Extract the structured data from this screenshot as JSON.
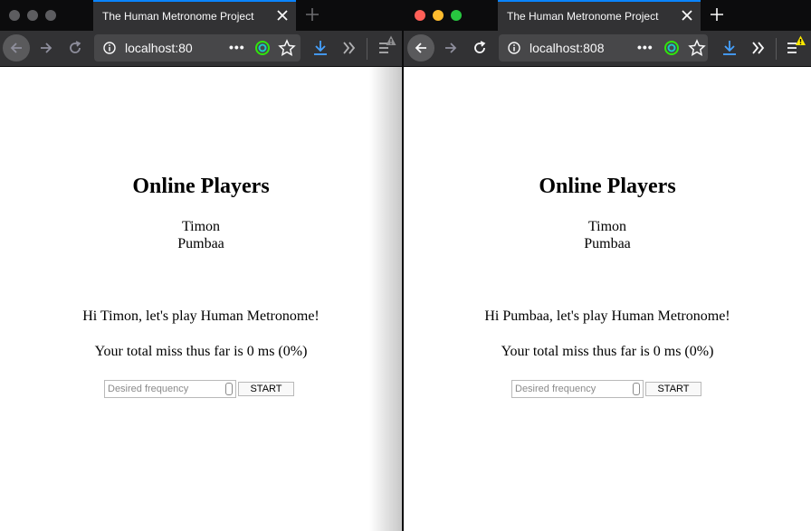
{
  "windows": {
    "left": {
      "tab_title": "The Human Metronome Project",
      "url": "localhost:80",
      "page": {
        "heading": "Online Players",
        "players": [
          "Timon",
          "Pumbaa"
        ],
        "greeting": "Hi Timon, let's play Human Metronome!",
        "miss_text": "Your total miss thus far is 0 ms (0%)",
        "frequency_placeholder": "Desired frequency",
        "start_label": "START"
      }
    },
    "right": {
      "tab_title": "The Human Metronome Project",
      "url": "localhost:808",
      "page": {
        "heading": "Online Players",
        "players": [
          "Timon",
          "Pumbaa"
        ],
        "greeting": "Hi Pumbaa, let's play Human Metronome!",
        "miss_text": "Your total miss thus far is 0 ms (0%)",
        "frequency_placeholder": "Desired frequency",
        "start_label": "START"
      }
    }
  },
  "colors": {
    "tab_accent": "#0a84ff",
    "toolbar_bg": "#323234",
    "urlbar_bg": "#474749",
    "traffic_red": "#ff5f57",
    "traffic_yellow": "#febc2e",
    "traffic_green": "#28c840",
    "warning_yellow": "#ffe900"
  },
  "icons": [
    "back-icon",
    "forward-icon",
    "reload-icon",
    "info-icon",
    "more-icon",
    "tracking-protection-icon",
    "bookmark-star-icon",
    "download-icon",
    "overflow-icon",
    "menu-icon",
    "warning-icon",
    "close-tab-icon",
    "new-tab-icon"
  ]
}
